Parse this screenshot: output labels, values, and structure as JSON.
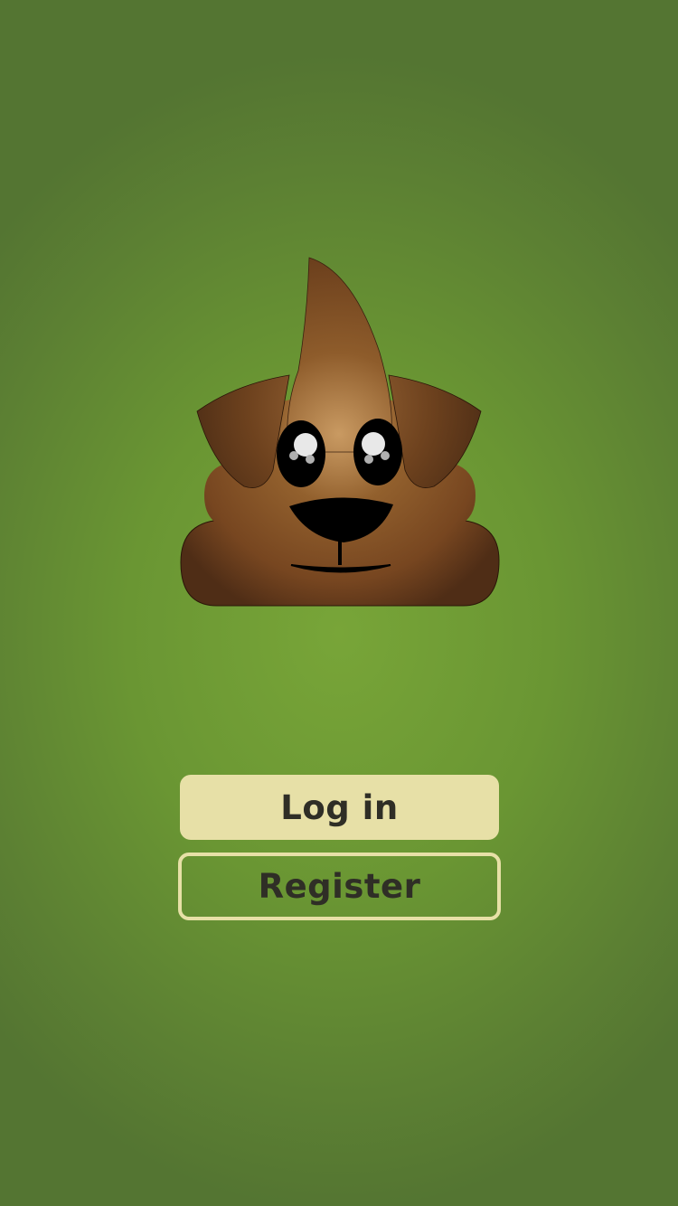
{
  "app": {
    "logo_icon": "poop-dog-mascot-icon"
  },
  "actions": {
    "login_label": "Log in",
    "register_label": "Register"
  },
  "colors": {
    "background": "#6a9633",
    "button_fill": "#e7e0a7",
    "button_text": "#2f2e26",
    "mascot_brown": "#7a4a22"
  }
}
